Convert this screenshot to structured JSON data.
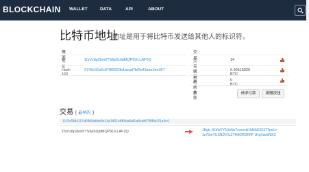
{
  "header": {
    "logo": "BLOCKCHAIN",
    "nav": [
      {
        "label": "WALLET"
      },
      {
        "label": "DATA"
      },
      {
        "label": "API"
      },
      {
        "label": "ABOUT"
      }
    ]
  },
  "page": {
    "title": "比特币地址",
    "subtitle": "地址是用于将比特币发送给其他人的标识符。"
  },
  "summary": {
    "title": "概要",
    "rows": [
      {
        "label": "地址",
        "value": "1fsVz8p2km6TS6p5UjdMQP9ULLAF2Q"
      },
      {
        "label": "Hash 160",
        "value": "9749c32e6c978f0620b1acad7bf2c43abc3be067"
      }
    ]
  },
  "transactions_box": {
    "title": "交易",
    "rows": [
      {
        "label": "交易次数",
        "value": "14"
      },
      {
        "label": "收到的总额",
        "value": "0.30515920 BTC"
      },
      {
        "label": "最终余额",
        "value": "0 BTC"
      }
    ],
    "buttons": {
      "request_payment": "请求付款",
      "donation_button": "捐赠按钮"
    }
  },
  "tx_section": {
    "title": "交易",
    "paren_open": "( ",
    "filter_link": "最早的",
    "paren_close": " )",
    "tx_hash": "11f2c6984117d0460a6de8e14e3461e8ff3ea6af1a8c4d07f9f4e2f1e4c4",
    "from_address": "1fsVz8p2km6TS6p5UjdMQP9ULLAF2Q",
    "to_line1": "1Bgb JGbW7Y5UkNn7cvxvxki1kMAD3337Tpu1e",
    "to_line2": "1z7SmYUSNDVJcZYH8GRDERF JKgXdsW3K3"
  },
  "colors": {
    "topbar": "#1d2d3f",
    "link": "#2c8fd6",
    "arrow": "#d9534f",
    "chart_icon": "#b55a3c"
  },
  "icons": [
    "search-icon",
    "bar-chart-icon",
    "right-arrow-icon"
  ]
}
